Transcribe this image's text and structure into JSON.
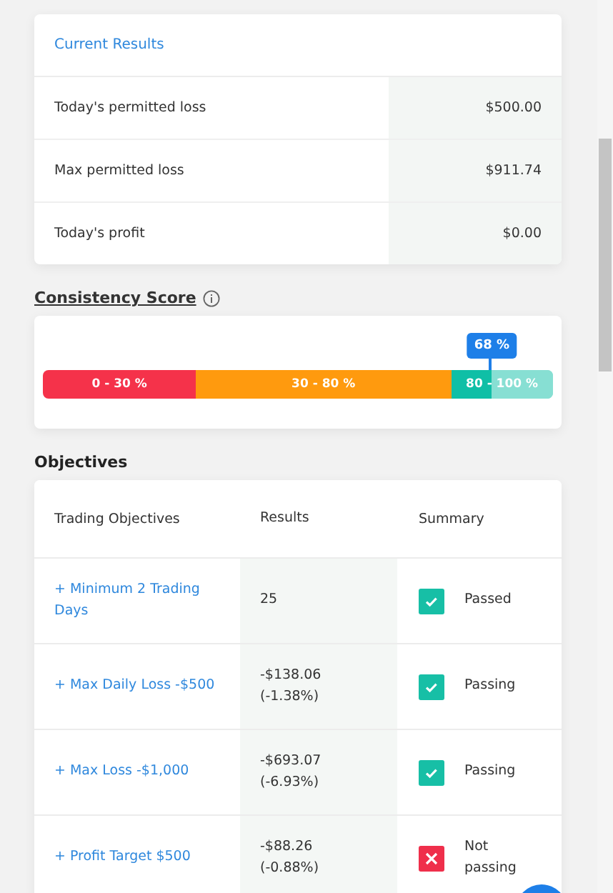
{
  "current_results": {
    "title": "Current Results",
    "rows": [
      {
        "label": "Today's permitted loss",
        "value": "$500.00"
      },
      {
        "label": "Max permitted loss",
        "value": "$911.74"
      },
      {
        "label": "Today's profit",
        "value": "$0.00"
      }
    ]
  },
  "consistency": {
    "title": "Consistency Score",
    "marker": {
      "label": "68 %",
      "level": 0.88
    },
    "segments": [
      {
        "label": "0 - 30 %",
        "color": "#f5324a"
      },
      {
        "label": "30 - 80 %",
        "color": "#ff9a0e"
      },
      {
        "label": "80 - 100 %",
        "color": "#0fbfa6"
      }
    ]
  },
  "objectives": {
    "title": "Objectives",
    "columns": [
      "Trading Objectives",
      "Results",
      "Summary"
    ],
    "rows": [
      {
        "objective": "+ Minimum 2 Trading Days",
        "result": "25",
        "passed": true,
        "summary": "Passed"
      },
      {
        "objective": "+ Max Daily Loss -$500",
        "result": "-$138.06 (-1.38%)",
        "passed": true,
        "summary": "Passing"
      },
      {
        "objective": "+ Max Loss -$1,000",
        "result": "-$693.07 (-6.93%)",
        "passed": true,
        "summary": "Passing"
      },
      {
        "objective": "+ Profit Target $500",
        "result": "-$88.26 (-0.88%)",
        "passed": false,
        "summary": "Not passing"
      }
    ]
  }
}
